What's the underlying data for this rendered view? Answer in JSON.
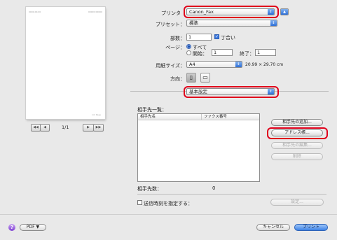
{
  "preview": {
    "header_left": "0000.00.00",
    "header_right": "00000 00000",
    "footer": "1/1 Page",
    "nav": {
      "first": "◀◀",
      "prev": "◀",
      "page": "1/1",
      "next": "▶",
      "last": "▶▶"
    }
  },
  "form": {
    "printer_label": "プリンタ",
    "printer_value": "Canon_Fax",
    "preset_label": "プリセット：",
    "preset_value": "標準",
    "copies_label": "部数：",
    "copies_value": "1",
    "collate_label": "丁合い",
    "pages_label": "ページ：",
    "all_label": "すべて",
    "from_label": "開始：",
    "from_value": "1",
    "to_label": "終了：",
    "to_value": "1",
    "paper_label": "用紙サイズ：",
    "paper_value": "A4",
    "paper_dims": "20.99 × 29.70 cm",
    "orientation_label": "方向：",
    "panel_value": "基本設定"
  },
  "destinations": {
    "title": "相手先一覧：",
    "col_name": "相手先名",
    "col_fax": "ファクス番号",
    "add_button": "相手先の追加...",
    "address_book_button": "アドレス帳...",
    "edit_button": "相手先の編集...",
    "delete_button": "削除",
    "count_label": "相手先数：",
    "count_value": "0",
    "send_time_label": "送信時刻を指定する：",
    "settings_button": "設定..."
  },
  "footer": {
    "help": "?",
    "pdf_button": "PDF ▼",
    "cancel_button": "キャンセル",
    "print_button": "プリント"
  },
  "colors": {
    "highlight_ring": "#e0001b",
    "accent": "#3d83e6"
  }
}
